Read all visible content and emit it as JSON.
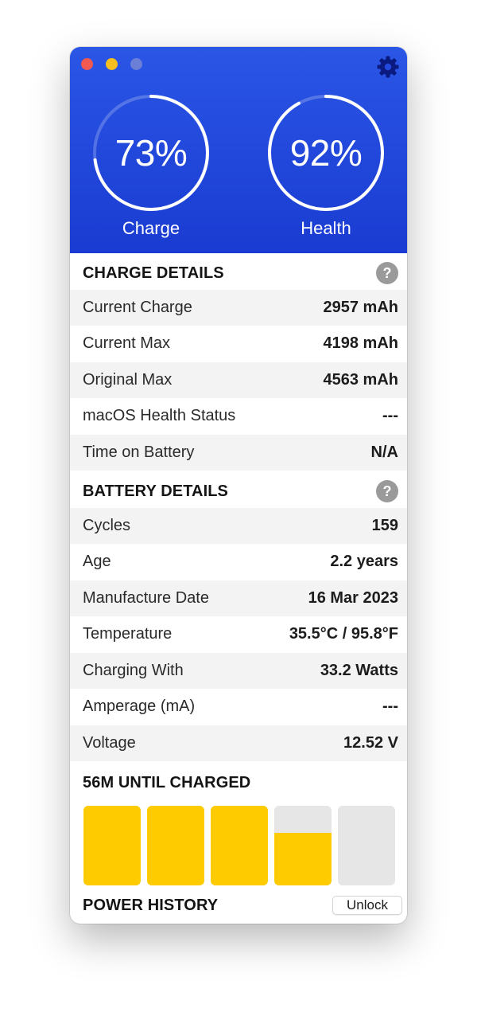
{
  "header": {
    "charge_value": "73%",
    "charge_label": "Charge",
    "charge_fraction": 0.73,
    "health_value": "92%",
    "health_label": "Health",
    "health_fraction": 0.92,
    "background_color": "#1f44dc"
  },
  "charge_details": {
    "title": "CHARGE DETAILS",
    "help_label": "?",
    "rows": [
      {
        "label": "Current Charge",
        "value": "2957 mAh"
      },
      {
        "label": "Current Max",
        "value": "4198 mAh"
      },
      {
        "label": "Original Max",
        "value": "4563 mAh"
      },
      {
        "label": "macOS Health Status",
        "value": "---"
      },
      {
        "label": "Time on Battery",
        "value": "N/A"
      }
    ]
  },
  "battery_details": {
    "title": "BATTERY DETAILS",
    "help_label": "?",
    "rows": [
      {
        "label": "Cycles",
        "value": "159"
      },
      {
        "label": "Age",
        "value": "2.2 years"
      },
      {
        "label": "Manufacture Date",
        "value": "16 Mar 2023"
      },
      {
        "label": "Temperature",
        "value": "35.5°C / 95.8°F"
      },
      {
        "label": "Charging With",
        "value": "33.2 Watts"
      },
      {
        "label": "Amperage (mA)",
        "value": "---"
      },
      {
        "label": "Voltage",
        "value": "12.52 V"
      }
    ]
  },
  "charging": {
    "title": "56M UNTIL CHARGED",
    "bar_fill_levels": [
      1.0,
      1.0,
      1.0,
      0.66,
      0.0
    ],
    "fill_color": "#fecb00",
    "empty_color": "#e6e6e6"
  },
  "power_history": {
    "title": "POWER HISTORY",
    "unlock_label": "Unlock"
  }
}
